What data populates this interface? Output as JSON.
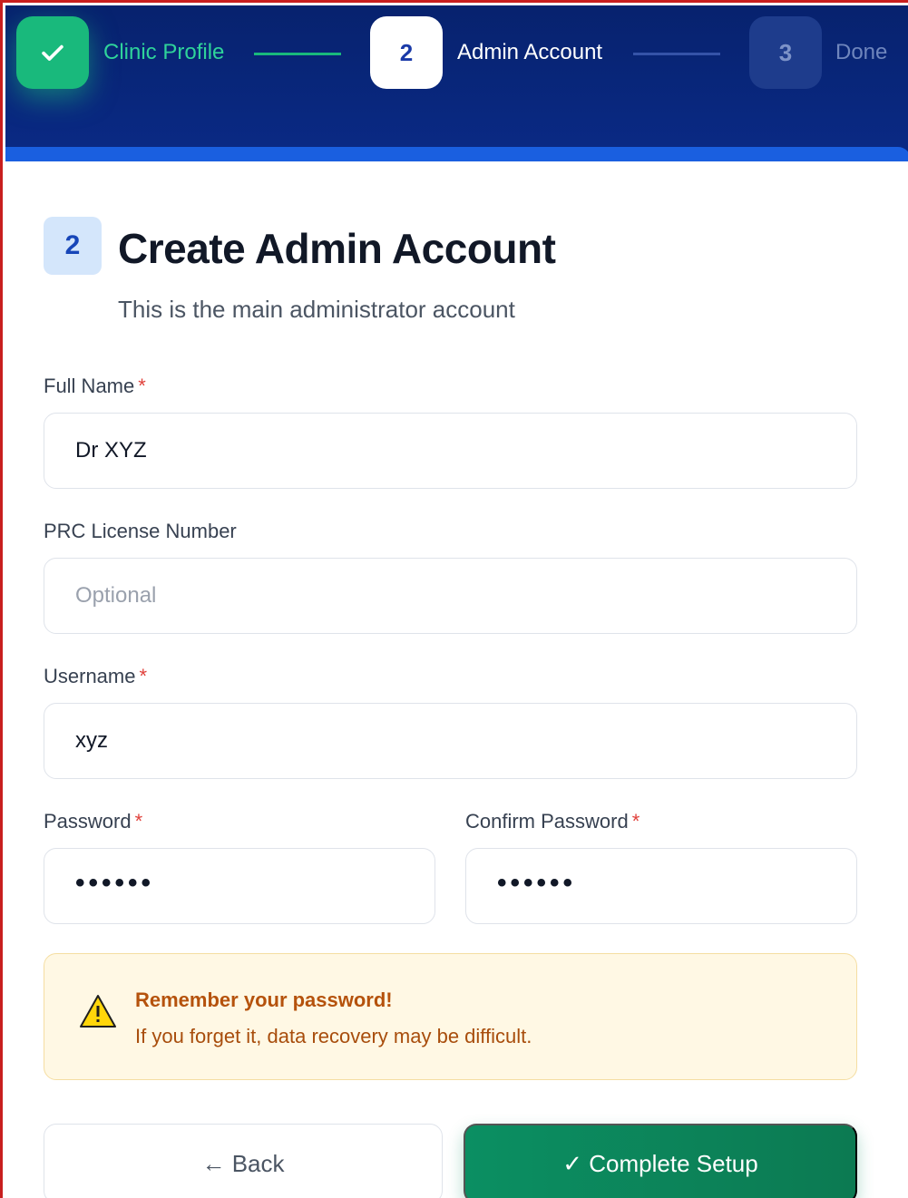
{
  "stepper": {
    "steps": [
      {
        "label": "Clinic Profile",
        "state": "completed",
        "icon": "check-icon"
      },
      {
        "number": "2",
        "label": "Admin Account",
        "state": "active"
      },
      {
        "number": "3",
        "label": "Done",
        "state": "upcoming"
      }
    ]
  },
  "section": {
    "badge": "2",
    "title": "Create Admin Account",
    "subtitle": "This is the main administrator account"
  },
  "form": {
    "full_name": {
      "label": "Full Name",
      "required_mark": "*",
      "value": "Dr XYZ"
    },
    "prc_license": {
      "label": "PRC License Number",
      "placeholder": "Optional"
    },
    "username": {
      "label": "Username",
      "required_mark": "*",
      "value": "xyz"
    },
    "password": {
      "label": "Password",
      "required_mark": "*",
      "value": "••••••"
    },
    "confirm_password": {
      "label": "Confirm Password",
      "required_mark": "*",
      "value": "••••••"
    }
  },
  "warning": {
    "icon": "warning-icon",
    "title": "Remember your password!",
    "text": "If you forget it, data recovery may be difficult."
  },
  "actions": {
    "back_label": "← Back",
    "complete_label": "✓ Complete Setup"
  },
  "colors": {
    "header_bg": "#082478",
    "success": "#19b97c",
    "accent": "#1a5fe0",
    "primary_button": "#0b8f62",
    "required": "#e0413b",
    "warning_bg": "#fff8e4"
  }
}
